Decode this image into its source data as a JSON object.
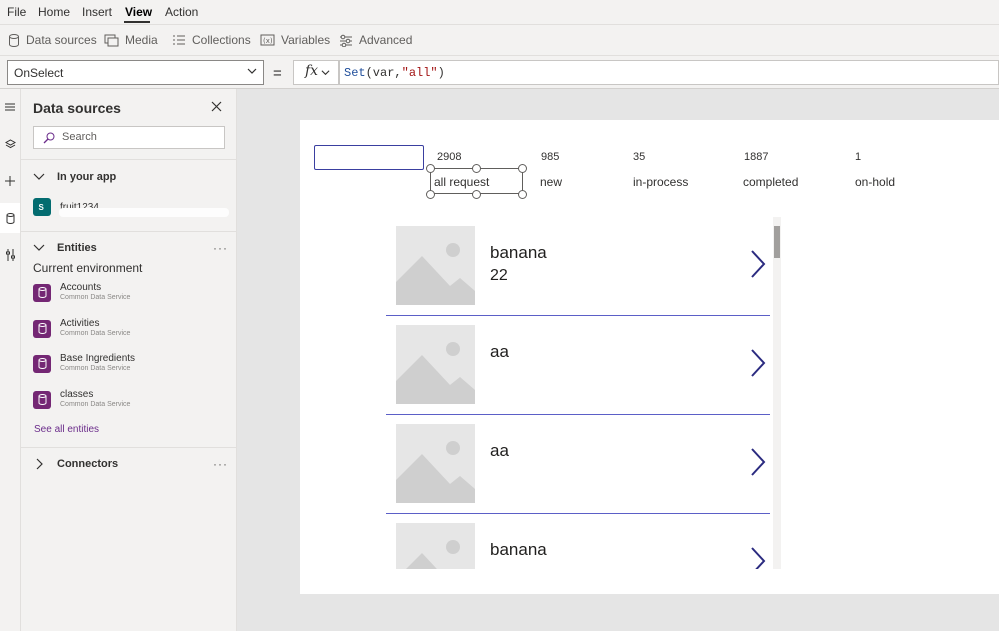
{
  "menu": {
    "items": [
      {
        "label": "File"
      },
      {
        "label": "Home"
      },
      {
        "label": "Insert"
      },
      {
        "label": "View"
      },
      {
        "label": "Action"
      }
    ],
    "active": "View"
  },
  "toolbar": {
    "data_sources": "Data sources",
    "media": "Media",
    "collections": "Collections",
    "variables": "Variables",
    "advanced": "Advanced"
  },
  "formula_bar": {
    "property": "OnSelect",
    "equals": "=",
    "fx": "fx",
    "formula_fn": "Set",
    "formula_open": "(var,",
    "formula_str": "\"all\"",
    "formula_close": ")"
  },
  "panel": {
    "title": "Data sources",
    "search_placeholder": "Search",
    "in_your_app": "In your app",
    "app_source": "fruit1234",
    "entities": "Entities",
    "current_environment": "Current environment",
    "entity_items": [
      {
        "name": "Accounts",
        "sub": "Common Data Service"
      },
      {
        "name": "Activities",
        "sub": "Common Data Service"
      },
      {
        "name": "Base Ingredients",
        "sub": "Common Data Service"
      },
      {
        "name": "classes",
        "sub": "Common Data Service"
      }
    ],
    "see_all": "See all entities",
    "connectors": "Connectors",
    "more": "···"
  },
  "stats": [
    {
      "count": "2908",
      "label": "all request"
    },
    {
      "count": "985",
      "label": "new"
    },
    {
      "count": "35",
      "label": "in-process"
    },
    {
      "count": "1887",
      "label": "completed"
    },
    {
      "count": "1",
      "label": "on-hold"
    }
  ],
  "gallery": [
    {
      "title": "banana",
      "subtitle": "22"
    },
    {
      "title": "aa",
      "subtitle": ""
    },
    {
      "title": "aa",
      "subtitle": ""
    },
    {
      "title": "banana",
      "subtitle": ""
    }
  ],
  "colors": {
    "accent": "#5b5fc7",
    "entity_icon": "#742774",
    "sharepoint_icon": "#036c70",
    "link": "#6b2d8b"
  }
}
